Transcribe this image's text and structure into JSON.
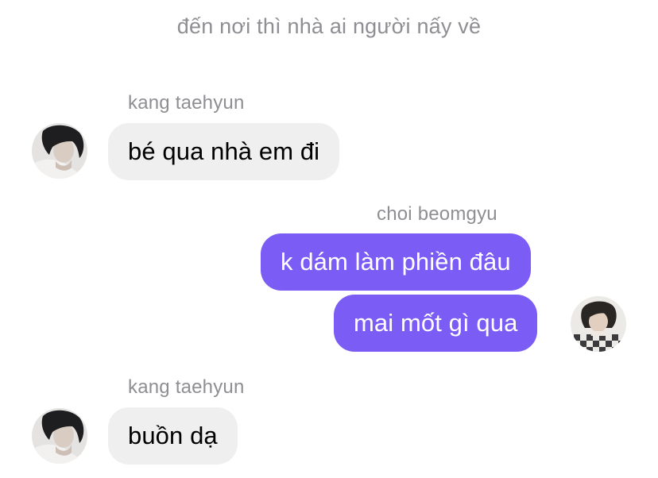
{
  "conversation": {
    "system_message": "đến nơi thì nhà ai người nấy về",
    "groups": [
      {
        "sender": "kang taehyun",
        "direction": "incoming",
        "messages": [
          "bé qua nhà em đi"
        ]
      },
      {
        "sender": "choi beomgyu",
        "direction": "outgoing",
        "messages": [
          "k dám làm phiền đâu",
          "mai mốt gì qua"
        ]
      },
      {
        "sender": "kang taehyun",
        "direction": "incoming",
        "messages": [
          "buồn dạ"
        ]
      }
    ]
  },
  "colors": {
    "outgoing_bubble": "#7b5cf5",
    "incoming_bubble": "#efefef",
    "meta_text": "#8e8e93"
  },
  "icons": {
    "avatar_incoming": "avatar-kang-taehyun-icon",
    "avatar_outgoing": "avatar-choi-beomgyu-icon"
  }
}
